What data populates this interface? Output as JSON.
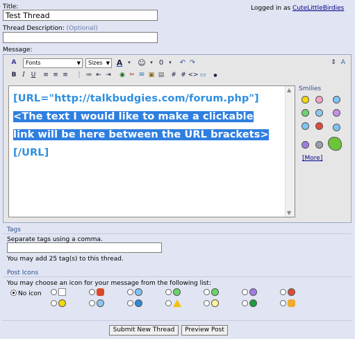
{
  "title_field": {
    "label": "Title:",
    "value": "Test Thread"
  },
  "login": {
    "prefix": "Logged in as",
    "user": "CuteLittleBirdies"
  },
  "description_field": {
    "label": "Thread Description:",
    "optional": "(Optional)",
    "value": ""
  },
  "message": {
    "label": "Message:",
    "toolbar": {
      "font_select": "Fonts",
      "size_select": "Sizes"
    },
    "line1": "[URL=\"http://talkbudgies.com/forum.php\"]",
    "line2": "<The text I would like to make a clickable",
    "line3": "link will be here between the URL brackets>",
    "line4": "[/URL]"
  },
  "smilies": {
    "title": "Smilies",
    "more": "[More]"
  },
  "tags": {
    "title": "Tags",
    "hint": "Separate tags using a comma.",
    "value": "",
    "note": "You may add 25 tag(s) to this thread."
  },
  "post_icons": {
    "title": "Post Icons",
    "hint": "You may choose an icon for your message from the following list:",
    "no_icon": "No icon"
  },
  "buttons": {
    "submit": "Submit New Thread",
    "preview": "Preview Post"
  }
}
